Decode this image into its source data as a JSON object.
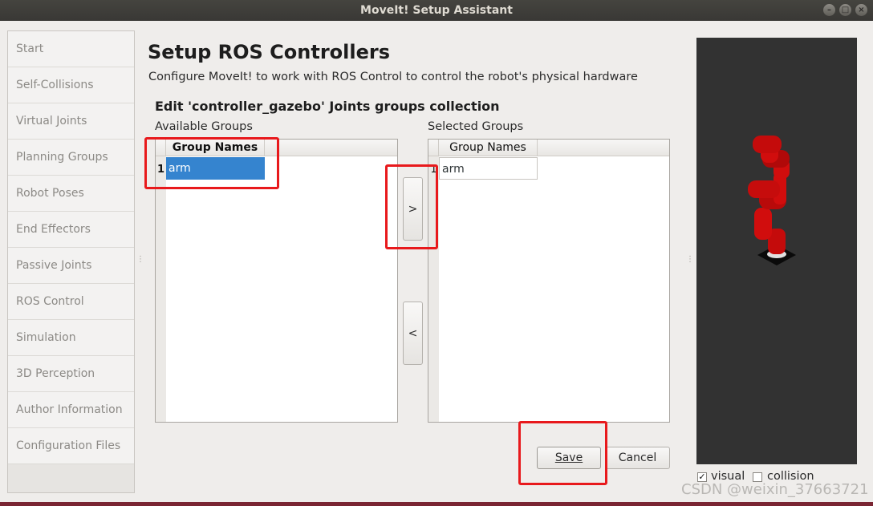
{
  "window": {
    "title": "MoveIt! Setup Assistant",
    "controls": [
      "minimize-icon",
      "maximize-icon",
      "close-icon"
    ]
  },
  "sidebar": {
    "items": [
      {
        "label": "Start"
      },
      {
        "label": "Self-Collisions"
      },
      {
        "label": "Virtual Joints"
      },
      {
        "label": "Planning Groups"
      },
      {
        "label": "Robot Poses"
      },
      {
        "label": "End Effectors"
      },
      {
        "label": "Passive Joints"
      },
      {
        "label": "ROS Control"
      },
      {
        "label": "Simulation"
      },
      {
        "label": "3D Perception"
      },
      {
        "label": "Author Information"
      },
      {
        "label": "Configuration Files"
      }
    ]
  },
  "main": {
    "title": "Setup ROS Controllers",
    "description": "Configure MoveIt! to work with ROS Control to control the robot's physical hardware",
    "section_title": "Edit 'controller_gazebo' Joints groups collection",
    "available": {
      "label": "Available Groups",
      "header": "Group Names",
      "rows": [
        {
          "index": "1",
          "name": "arm",
          "selected": true
        }
      ]
    },
    "selected": {
      "label": "Selected Groups",
      "header": "Group Names",
      "rows": [
        {
          "index": "1",
          "name": "arm"
        }
      ]
    },
    "add_button": ">",
    "remove_button": "<",
    "save_button": "Save",
    "cancel_button": "Cancel"
  },
  "viewer": {
    "background": "#323232",
    "robot_color": "#d10d0d",
    "visual_label": "visual",
    "visual_checked": true,
    "collision_label": "collision",
    "collision_checked": false
  },
  "watermark": "CSDN @weixin_37663721",
  "colors": {
    "selection": "#3584cf",
    "highlight_box": "#e8191c"
  }
}
